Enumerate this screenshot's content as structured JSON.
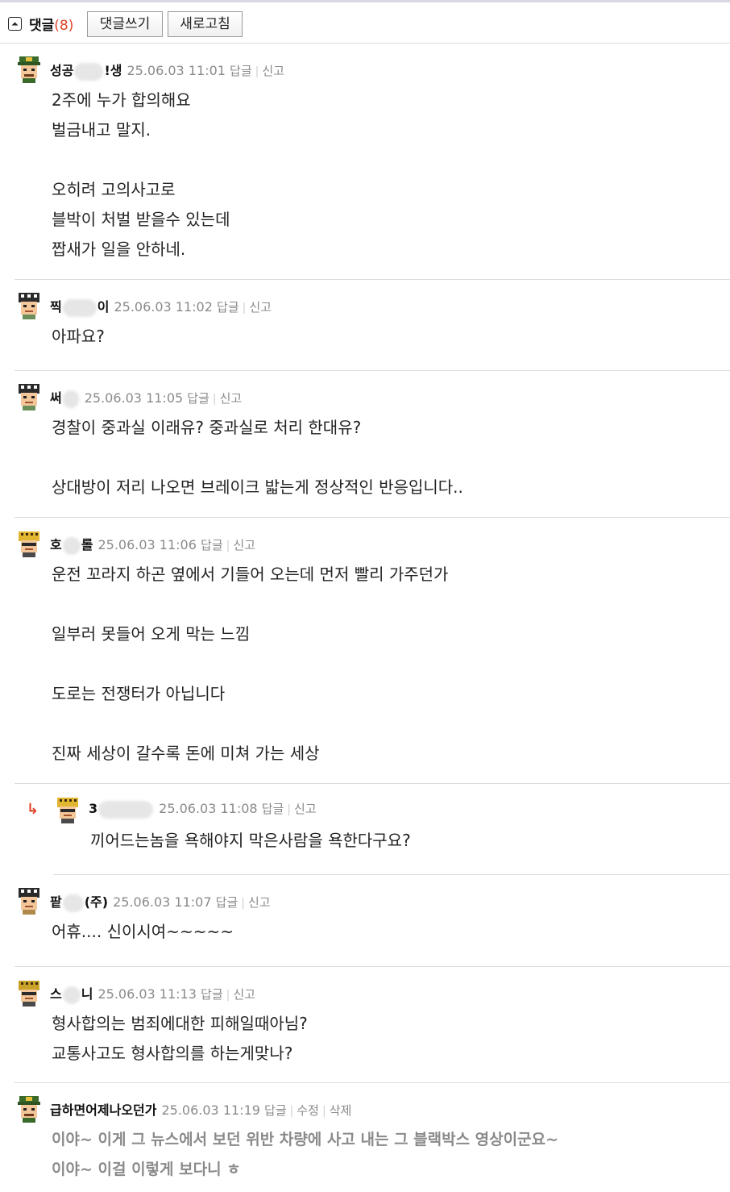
{
  "header": {
    "title": "댓글",
    "count": "(8)",
    "write_label": "댓글쓰기",
    "refresh_label": "새로고침"
  },
  "comments": [
    {
      "nick_a": "성공",
      "nick_b": "!생",
      "date": "25.06.03 11:01",
      "reply": "답글",
      "report": "신고",
      "lines": [
        "2주에 누가 합의해요",
        "벌금내고 말지.",
        "",
        "오히려 고의사고로",
        "블박이 처벌 받을수 있는데",
        "짭새가 일을 안하네."
      ]
    },
    {
      "nick_a": "찍",
      "nick_b": "이",
      "date": "25.06.03 11:02",
      "reply": "답글",
      "report": "신고",
      "lines": [
        "아파요?"
      ]
    },
    {
      "nick_a": "써",
      "nick_b": "",
      "date": "25.06.03 11:05",
      "reply": "답글",
      "report": "신고",
      "lines": [
        "경찰이 중과실 이래유? 중과실로 처리 한대유?",
        "",
        "상대방이 저리 나오면 브레이크 밟는게 정상적인 반응입니다.."
      ]
    },
    {
      "nick_a": "호",
      "nick_b": "롤",
      "date": "25.06.03 11:06",
      "reply": "답글",
      "report": "신고",
      "lines": [
        "운전 꼬라지 하곤 옆에서 기들어 오는데 먼저 빨리 가주던가",
        "",
        "일부러 못들어 오게 막는 느낌",
        "",
        "도로는 전쟁터가 아닙니다",
        "",
        "진짜 세상이 갈수록 돈에 미쳐 가는 세상"
      ]
    },
    {
      "nick_a": "3",
      "nick_b": "",
      "date": "25.06.03 11:08",
      "reply": "답글",
      "report": "신고",
      "lines": [
        "끼어드는놈을 욕해야지 막은사람을 욕한다구요?"
      ]
    },
    {
      "nick_a": "팥",
      "nick_b": "(주)",
      "date": "25.06.03 11:07",
      "reply": "답글",
      "report": "신고",
      "lines": [
        "어휴.... 신이시여~~~~~"
      ]
    },
    {
      "nick_a": "스",
      "nick_b": "니",
      "date": "25.06.03 11:13",
      "reply": "답글",
      "report": "신고",
      "lines": [
        "형사합의는 범죄에대한 피해일때아님?",
        "교통사고도 형사합의를 하는게맞나?"
      ]
    },
    {
      "nick_a": "급하면어제나오던가",
      "date": "25.06.03 11:19",
      "reply": "답글",
      "edit": "수정",
      "delete": "삭제",
      "lines": [
        "이야~ 이게 그 뉴스에서 보던 위반 차량에 사고 내는 그 블랙박스 영상이군요~",
        "이야~ 이걸 이렇게 보다니 ㅎ"
      ]
    }
  ],
  "icons": {
    "collapse": "collapse-up-icon",
    "reply_arrow": "reply-arrow-icon",
    "avatar": "pixel-character-avatar-icon"
  },
  "colors": {
    "count": "#e0452b",
    "meta": "#8a8a8a",
    "divider": "#dcdcdc"
  }
}
